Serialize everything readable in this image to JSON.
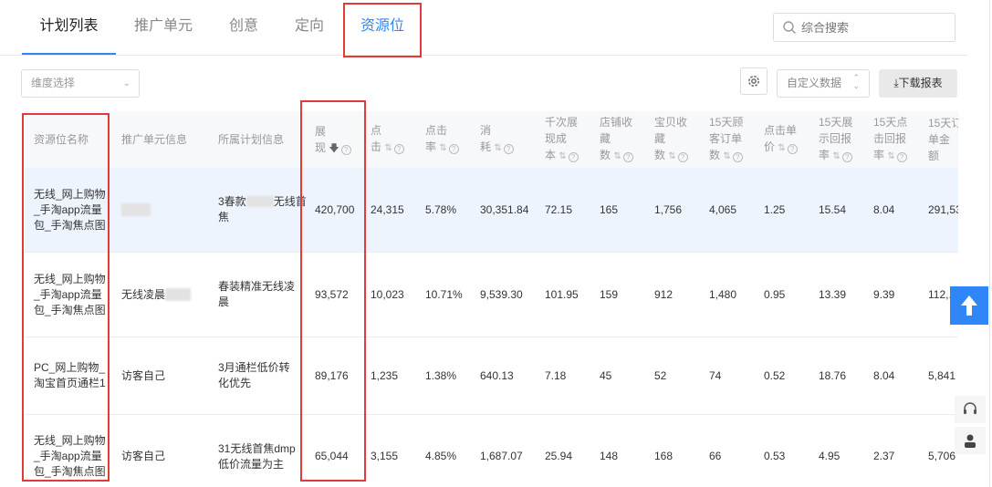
{
  "tabs": [
    "计划列表",
    "推广单元",
    "创意",
    "定向",
    "资源位"
  ],
  "search": {
    "placeholder": "综合搜索"
  },
  "dimension_select": {
    "label": "维度选择"
  },
  "toolbar": {
    "custom_data_label": "自定义数据",
    "download_label": "下载报表"
  },
  "table": {
    "headers": {
      "resource": "资源位名称",
      "unit_info": "推广单元信息",
      "plan_info": "所属计划信息",
      "impressions": [
        "展",
        "现"
      ],
      "clicks": [
        "点",
        "击"
      ],
      "ctr": [
        "点击",
        "率"
      ],
      "cost": [
        "消",
        "耗"
      ],
      "cpm": [
        "千次展",
        "现成",
        "本"
      ],
      "store_fav": [
        "店铺收",
        "藏",
        "数"
      ],
      "item_fav": [
        "宝贝收",
        "藏",
        "数"
      ],
      "orders15": [
        "15天顾",
        "客订单",
        "数"
      ],
      "cpc": [
        "点击单",
        "价"
      ],
      "roi15": [
        "15天展",
        "示回报",
        "率"
      ],
      "click_roi15": [
        "15天点",
        "击回报",
        "率"
      ],
      "amount15": [
        "15天订",
        "单金",
        "额"
      ]
    },
    "rows": [
      {
        "resource": "无线_网上购物_手淘app流量包_手淘焦点图",
        "unit": "",
        "plan_a": "3春款",
        "plan_b": "无线首焦",
        "impressions": "420,700",
        "clicks": "24,315",
        "ctr": "5.78%",
        "cost": "30,351.84",
        "cpm": "72.15",
        "store_fav": "165",
        "item_fav": "1,756",
        "orders15": "4,065",
        "cpc": "1.25",
        "roi15": "15.54",
        "click_roi15": "8.04",
        "amount15": "291,53"
      },
      {
        "resource": "无线_网上购物_手淘app流量包_手淘焦点图",
        "unit": "无线凌晨",
        "plan_a": "春装精准无线凌晨",
        "plan_b": "",
        "impressions": "93,572",
        "clicks": "10,023",
        "ctr": "10.71%",
        "cost": "9,539.30",
        "cpm": "101.95",
        "store_fav": "159",
        "item_fav": "912",
        "orders15": "1,480",
        "cpc": "0.95",
        "roi15": "13.39",
        "click_roi15": "9.39",
        "amount15": "112,..."
      },
      {
        "resource": "PC_网上购物_淘宝首页通栏1",
        "unit": "访客自己",
        "plan_a": "3月通栏低价转化优先",
        "plan_b": "",
        "impressions": "89,176",
        "clicks": "1,235",
        "ctr": "1.38%",
        "cost": "640.13",
        "cpm": "7.18",
        "store_fav": "45",
        "item_fav": "52",
        "orders15": "74",
        "cpc": "0.52",
        "roi15": "18.76",
        "click_roi15": "8.04",
        "amount15": "5,841"
      },
      {
        "resource": "无线_网上购物_手淘app流量包_手淘焦点图",
        "unit": "访客自己",
        "plan_a": "31无线首焦dmp低价流量为主",
        "plan_b": "",
        "impressions": "65,044",
        "clicks": "3,155",
        "ctr": "4.85%",
        "cost": "1,687.07",
        "cpm": "25.94",
        "store_fav": "148",
        "item_fav": "168",
        "orders15": "66",
        "cpc": "0.53",
        "roi15": "4.95",
        "click_roi15": "2.37",
        "amount15": "5,706"
      }
    ]
  },
  "colors": {
    "accent": "#2f86f6",
    "highlight_box": "#e03a3a",
    "row_highlight": "#eef4fd"
  }
}
